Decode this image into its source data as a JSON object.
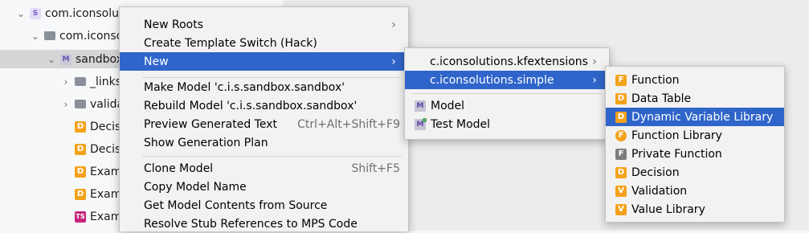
{
  "tree": {
    "rows": [
      {
        "label": "com.iconsolutions.simple.sandbox",
        "chevron": "⌄",
        "icon": "solution-icon",
        "glyph": "S"
      },
      {
        "label": "com.iconsolutions.sandbox",
        "chevron": "⌄",
        "icon": "folder-icon",
        "glyph": ""
      },
      {
        "label": "sandbox",
        "chevron": "⌄",
        "icon": "model-icon",
        "glyph": "M"
      },
      {
        "label": "_links",
        "chevron": "›",
        "icon": "folder-icon",
        "glyph": ""
      },
      {
        "label": "validations",
        "chevron": "›",
        "icon": "folder-icon",
        "glyph": ""
      },
      {
        "label": "Decision",
        "chevron": "",
        "icon": "decision-icon",
        "glyph": "D"
      },
      {
        "label": "Decision",
        "chevron": "",
        "icon": "decision-icon",
        "glyph": "D"
      },
      {
        "label": "Example",
        "chevron": "",
        "icon": "decision-icon",
        "glyph": "D"
      },
      {
        "label": "Example",
        "chevron": "",
        "icon": "decision-icon",
        "glyph": "D"
      },
      {
        "label": "Example",
        "chevron": "",
        "icon": "test-suite-icon",
        "glyph": "TS"
      }
    ]
  },
  "context_menu": {
    "items": [
      {
        "label": "New Roots",
        "shortcut": "",
        "submenu": true
      },
      {
        "label": "Create Template Switch (Hack)",
        "shortcut": "",
        "submenu": false
      },
      {
        "label": "New",
        "shortcut": "",
        "submenu": true,
        "highlighted": true
      },
      {
        "label": "Make Model 'c.i.s.sandbox.sandbox'",
        "shortcut": "",
        "submenu": false
      },
      {
        "label": "Rebuild Model 'c.i.s.sandbox.sandbox'",
        "shortcut": "",
        "submenu": false
      },
      {
        "label": "Preview Generated Text",
        "shortcut": "Ctrl+Alt+Shift+F9",
        "submenu": false
      },
      {
        "label": "Show Generation Plan",
        "shortcut": "",
        "submenu": false
      },
      {
        "label": "Clone Model",
        "shortcut": "Shift+F5",
        "submenu": false
      },
      {
        "label": "Copy Model Name",
        "shortcut": "",
        "submenu": false
      },
      {
        "label": "Get Model Contents from Source",
        "shortcut": "",
        "submenu": false
      },
      {
        "label": "Resolve Stub References to MPS Code",
        "shortcut": "",
        "submenu": false
      }
    ]
  },
  "new_submenu": {
    "items": [
      {
        "label": "c.iconsolutions.kfextensions",
        "icon": "",
        "submenu": true
      },
      {
        "label": "c.iconsolutions.simple",
        "icon": "",
        "submenu": true,
        "highlighted": true
      },
      {
        "label": "Model",
        "icon": "model-icon",
        "glyph": "M",
        "submenu": false
      },
      {
        "label": "Test Model",
        "icon": "test-model-icon",
        "glyph": "M",
        "submenu": false
      }
    ]
  },
  "simple_submenu": {
    "items": [
      {
        "label": "Function",
        "icon": "function-icon",
        "glyph": "F"
      },
      {
        "label": "Data Table",
        "icon": "data-table-icon",
        "glyph": "D"
      },
      {
        "label": "Dynamic Variable Library",
        "icon": "dynamic-variable-library-icon",
        "glyph": "D",
        "highlighted": true
      },
      {
        "label": "Function Library",
        "icon": "function-library-icon",
        "glyph": "F"
      },
      {
        "label": "Private Function",
        "icon": "private-function-icon",
        "glyph": "F"
      },
      {
        "label": "Decision",
        "icon": "decision-icon",
        "glyph": "D"
      },
      {
        "label": "Validation",
        "icon": "validation-icon",
        "glyph": "V"
      },
      {
        "label": "Value Library",
        "icon": "value-library-icon",
        "glyph": "V"
      }
    ]
  },
  "colors": {
    "highlight": "#2f65ca",
    "menu_background": "#f2f2f2",
    "tree_selection": "#d5d5d5",
    "concept_icon_orange": "#f4a21b"
  }
}
